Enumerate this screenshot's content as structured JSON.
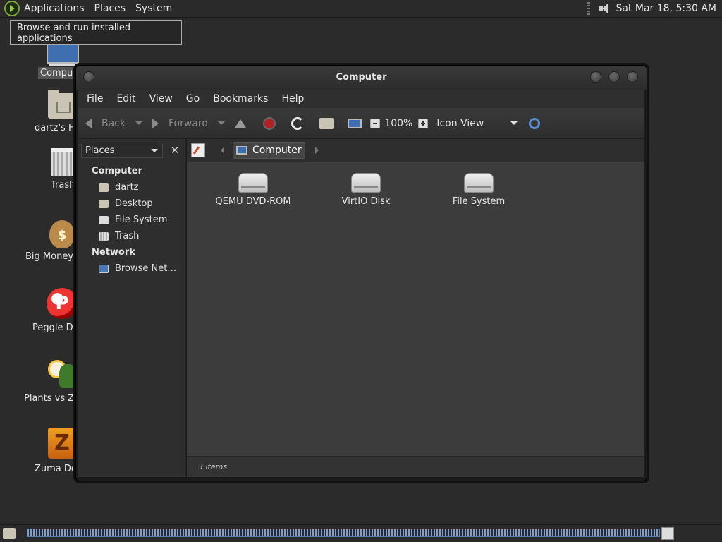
{
  "top_panel": {
    "menus": [
      "Applications",
      "Places",
      "System"
    ],
    "clock": "Sat Mar 18,  5:30 AM"
  },
  "tooltip": "Browse and run installed applications",
  "desktop": {
    "icons": [
      {
        "label": "Compu",
        "icon": "computer-icon"
      },
      {
        "label": "dartz's H",
        "icon": "home-folder-icon"
      },
      {
        "label": "Trash",
        "icon": "trash-icon"
      },
      {
        "label": "Big Money I",
        "icon": "money-bag-icon"
      },
      {
        "label": "Peggle De",
        "icon": "peggle-icon"
      },
      {
        "label": "Plants vs Zo",
        "icon": "plants-icon"
      },
      {
        "label": "Zuma De",
        "icon": "zuma-icon"
      }
    ]
  },
  "window": {
    "title": "Computer",
    "menubar": [
      "File",
      "Edit",
      "View",
      "Go",
      "Bookmarks",
      "Help"
    ],
    "toolbar": {
      "back": "Back",
      "forward": "Forward",
      "zoom": "100%",
      "view_mode": "Icon View"
    },
    "sidebar": {
      "combo": "Places",
      "sections": [
        {
          "title": "Computer",
          "items": [
            "dartz",
            "Desktop",
            "File System",
            "Trash"
          ]
        },
        {
          "title": "Network",
          "items": [
            "Browse Net…"
          ]
        }
      ]
    },
    "location": {
      "crumb": "Computer"
    },
    "files": [
      {
        "label": "QEMU DVD-ROM",
        "icon": "optical-drive-icon"
      },
      {
        "label": "VirtIO Disk",
        "icon": "hard-drive-icon"
      },
      {
        "label": "File System",
        "icon": "hard-drive-icon"
      }
    ],
    "status": "3 items"
  }
}
